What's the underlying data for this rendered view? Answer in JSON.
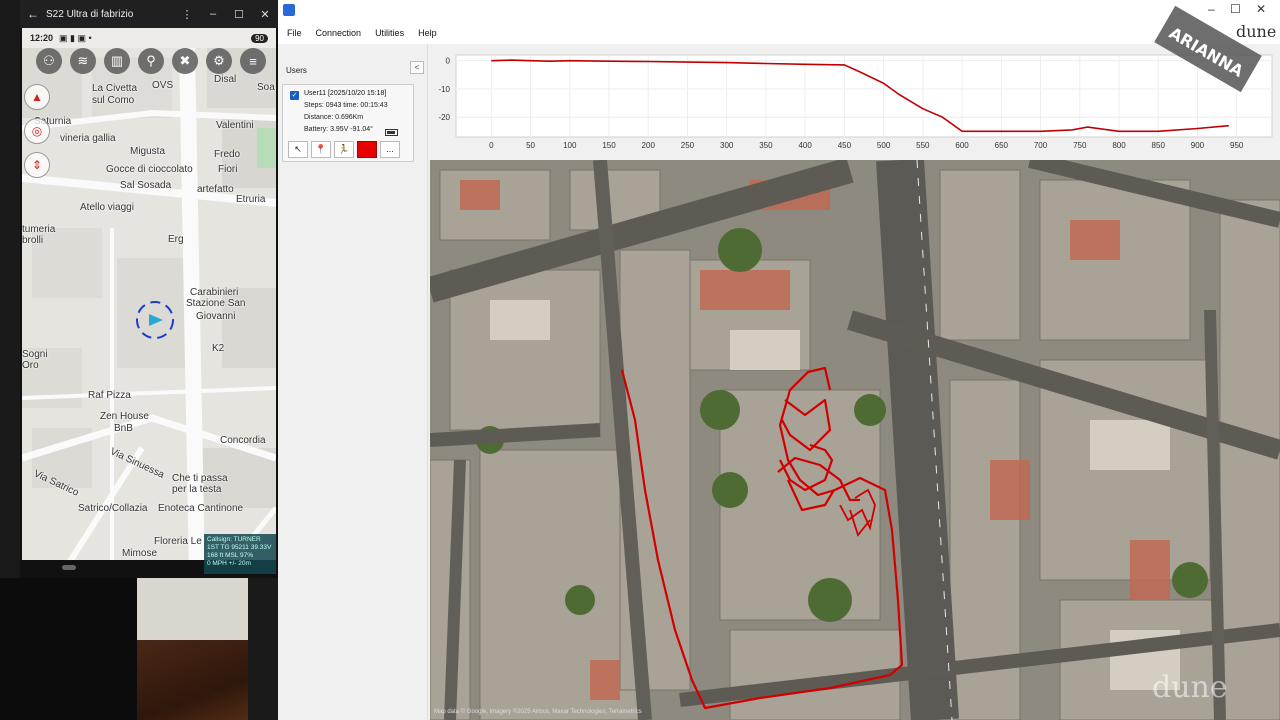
{
  "phone": {
    "window_title": "S22 Ultra di fabrizio",
    "status_time": "12:20",
    "battery": "90",
    "map_labels": [
      "La Civetta",
      "sul Como",
      "OVS",
      "Disal",
      "Soa",
      "Saturnia",
      "vineria gallia",
      "Valentini",
      "Migusta",
      "Fredo",
      "Gocce di cioccolato",
      "Fiori",
      "Sal Sosada",
      "artefatto",
      "Etruria",
      "Atello viaggi",
      "tumeria",
      "brolli",
      "Erg",
      "Carabinieri",
      "Stazione San",
      "Giovanni",
      "K2",
      "Sogni",
      "Oro",
      "Raf Pizza",
      "Zen House",
      "BnB",
      "Concordia",
      "Via Sinuessa",
      "Via Satrico",
      "Che ti passa",
      "per la testa",
      "Satrico/Collazia",
      "Enoteca Cantinone",
      "Floreria Le",
      "Mimose"
    ],
    "info_box": [
      "Callsign: TURNER",
      "1ST TG 95211  39.33V",
      "168 ft MSL      97%",
      "0 MPH        +/- 20m"
    ]
  },
  "app": {
    "menu": [
      "File",
      "Connection",
      "Utilities",
      "Help"
    ],
    "window_controls": [
      "–",
      "☐",
      "✕"
    ],
    "users_panel": {
      "header": "Users",
      "collapse": "<",
      "user": {
        "name": "User11   [2025/10/20 15:18]",
        "steps": "Steps: 0943 time: 00:15:43",
        "distance": "Distance: 0.696Km",
        "battery": "Battery: 3.95V -91.04°"
      },
      "actions": [
        "↖",
        "📍",
        "🏃",
        "",
        "..."
      ]
    },
    "map_attribution": "Map data © Google, Imagery ©2025 Airbus, Maxar Technologies, Terrametrics"
  },
  "logos": {
    "top": "dune",
    "badge": "ARIANNA",
    "bottom": "dune"
  },
  "colors": {
    "track": "#cc0000",
    "accent": "#1a5fbf"
  },
  "chart_data": {
    "type": "line",
    "x_ticks": [
      0,
      50,
      100,
      150,
      200,
      250,
      300,
      350,
      400,
      450,
      500,
      550,
      600,
      650,
      700,
      750,
      800,
      850,
      900,
      950
    ],
    "y_ticks": [
      0,
      -10,
      -20
    ],
    "xlim": [
      -45,
      995
    ],
    "ylim": [
      -27,
      2
    ],
    "grid": true,
    "series": [
      {
        "x": [
          0,
          25,
          50,
          75,
          100,
          150,
          200,
          250,
          300,
          350,
          400,
          450,
          470,
          500,
          520,
          550,
          575,
          600,
          650,
          700,
          740,
          760,
          800,
          850,
          900,
          940
        ],
        "y": [
          0,
          0.2,
          0,
          -0.2,
          0,
          -0.2,
          -0.3,
          -0.5,
          -0.7,
          -1,
          -1.3,
          -1.5,
          -4,
          -8,
          -12,
          -17,
          -20,
          -25,
          -25,
          -25,
          -24.5,
          -23.5,
          -25,
          -25,
          -24,
          -23
        ]
      }
    ]
  }
}
